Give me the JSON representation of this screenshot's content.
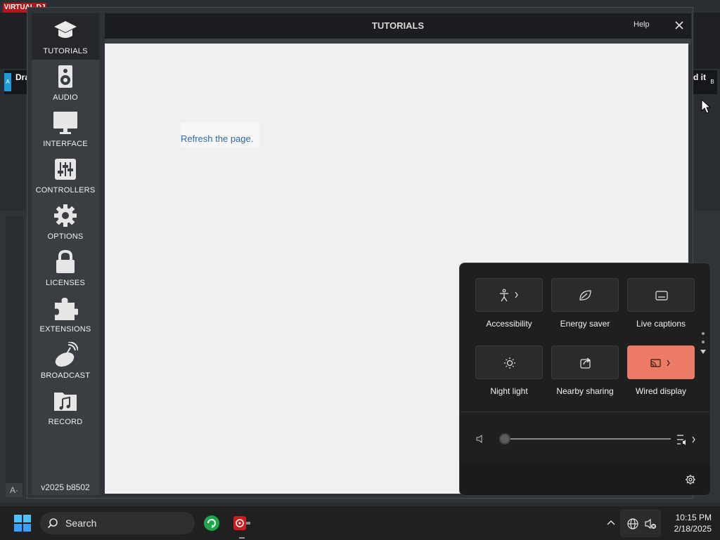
{
  "background_app": {
    "logo": "VIRTUAL DJ",
    "deck_left_title": "Dra",
    "deck_right_title": "d it",
    "deck_left_letter": "A",
    "deck_right_letter": "B"
  },
  "window": {
    "title": "TUTORIALS",
    "help_label": "Help",
    "version": "v2025 b8502"
  },
  "sidebar": {
    "items": [
      {
        "label": "TUTORIALS",
        "icon": "graduation-cap-icon",
        "active": true
      },
      {
        "label": "AUDIO",
        "icon": "speaker-icon"
      },
      {
        "label": "INTERFACE",
        "icon": "monitor-icon"
      },
      {
        "label": "CONTROLLERS",
        "icon": "sliders-icon"
      },
      {
        "label": "OPTIONS",
        "icon": "gear-icon"
      },
      {
        "label": "LICENSES",
        "icon": "lock-icon"
      },
      {
        "label": "EXTENSIONS",
        "icon": "puzzle-icon"
      },
      {
        "label": "BROADCAST",
        "icon": "satellite-dish-icon"
      },
      {
        "label": "RECORD",
        "icon": "music-folder-icon"
      }
    ]
  },
  "content": {
    "refresh_link": "Refresh the page."
  },
  "quick_settings": {
    "tiles": [
      {
        "label": "Accessibility",
        "icon": "accessibility-icon",
        "active": false
      },
      {
        "label": "Energy saver",
        "icon": "leaf-icon",
        "active": false
      },
      {
        "label": "Live captions",
        "icon": "captions-icon",
        "active": false
      },
      {
        "label": "Night light",
        "icon": "brightness-icon",
        "active": false
      },
      {
        "label": "Nearby sharing",
        "icon": "share-icon",
        "active": false
      },
      {
        "label": "Wired display",
        "icon": "cast-icon",
        "active": true
      }
    ],
    "volume_level": 0,
    "accent_color": "#ec7b66"
  },
  "taskbar": {
    "search_label": "Search",
    "time": "10:15 PM",
    "date": "2/18/2025"
  }
}
